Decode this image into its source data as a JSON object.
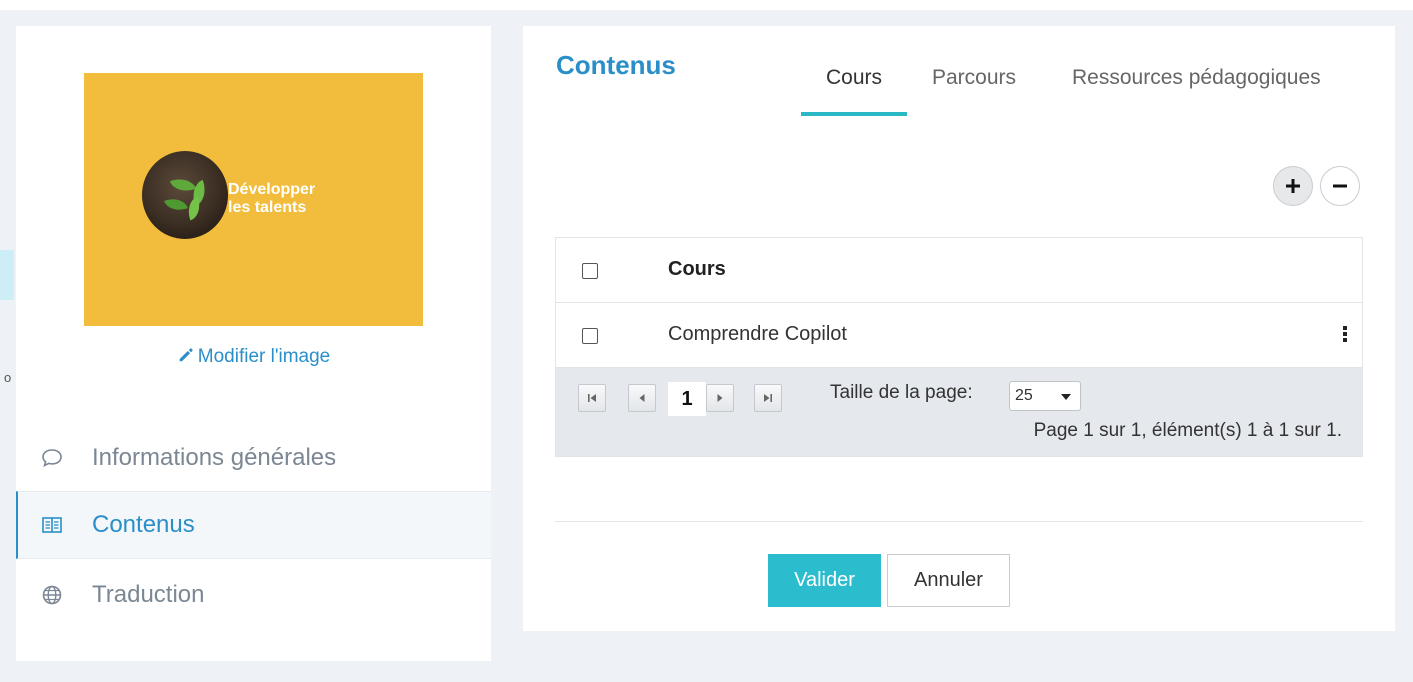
{
  "colors": {
    "accent": "#2a8fc9",
    "tab_underline": "#2ab7c6",
    "validate_bg": "#2bbcce",
    "image_bg": "#f2bd3c"
  },
  "left_panel": {
    "image_caption_line1": "Développer",
    "image_caption_line2": "les talents",
    "modify_image_label": "Modifier l'image",
    "nav": [
      {
        "label": "Informations générales",
        "icon": "comment-icon"
      },
      {
        "label": "Contenus",
        "icon": "book-icon"
      },
      {
        "label": "Traduction",
        "icon": "globe-icon"
      }
    ],
    "edge_mark": "o"
  },
  "right_panel": {
    "title": "Contenus",
    "tabs": [
      {
        "label": "Cours",
        "active": true
      },
      {
        "label": "Parcours",
        "active": false
      },
      {
        "label": "Ressources pédagogiques",
        "active": false
      }
    ],
    "grid": {
      "column_header": "Cours",
      "rows": [
        {
          "title": "Comprendre Copilot"
        }
      ]
    },
    "pager": {
      "current_page": "1",
      "page_size_label": "Taille de la page:",
      "page_size_value": "25",
      "page_info": "Page 1 sur 1, élément(s) 1 à 1 sur 1."
    },
    "buttons": {
      "validate": "Valider",
      "cancel": "Annuler"
    }
  }
}
